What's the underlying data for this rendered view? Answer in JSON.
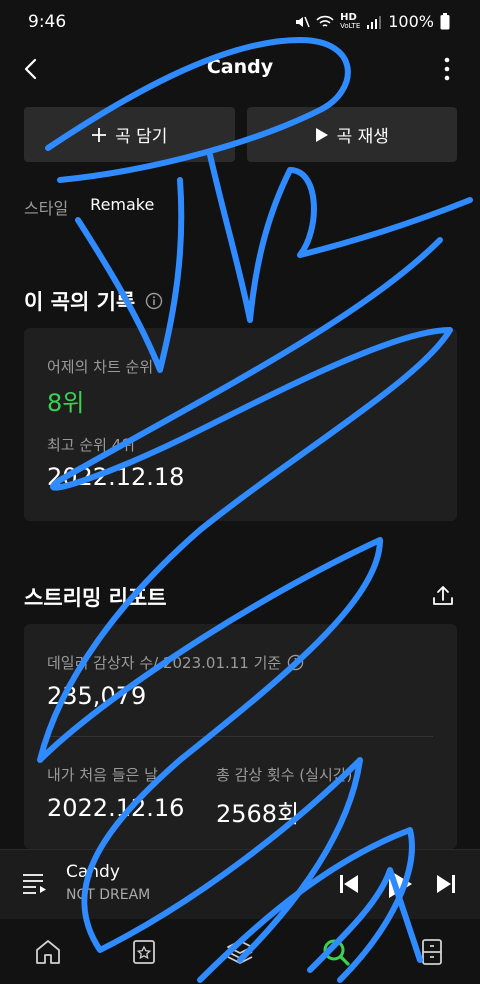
{
  "status_bar": {
    "time": "9:46",
    "network_label": "HD",
    "network_sub": "VoLTE",
    "battery": "100%"
  },
  "header": {
    "title": "Candy"
  },
  "actions": {
    "add_label": "곡 담기",
    "play_label": "곡 재생"
  },
  "style": {
    "label": "스타일",
    "value": "Remake"
  },
  "record": {
    "title": "이 곡의 기록",
    "chart_label": "어제의 차트 순위",
    "chart_value": "8위",
    "best_label": "최고 순위 4위",
    "best_date": "2022.12.18"
  },
  "report": {
    "title": "스트리밍 리포트",
    "daily_label": "데일리 감상자 수/ 2023.01.11 기준",
    "daily_value": "235,079",
    "first_label": "내가 처음 들은 날",
    "first_value": "2022.12.16",
    "total_label": "총 감상 횟수 (실시간)",
    "total_value": "2568회"
  },
  "now_playing": {
    "title": "Candy",
    "artist": "NCT DREAM"
  },
  "colors": {
    "accent_green": "#39d353",
    "scribble_blue": "#2f8bff"
  },
  "nav": [
    "home-icon",
    "library-icon",
    "layers-icon",
    "search-icon",
    "storage-icon"
  ]
}
